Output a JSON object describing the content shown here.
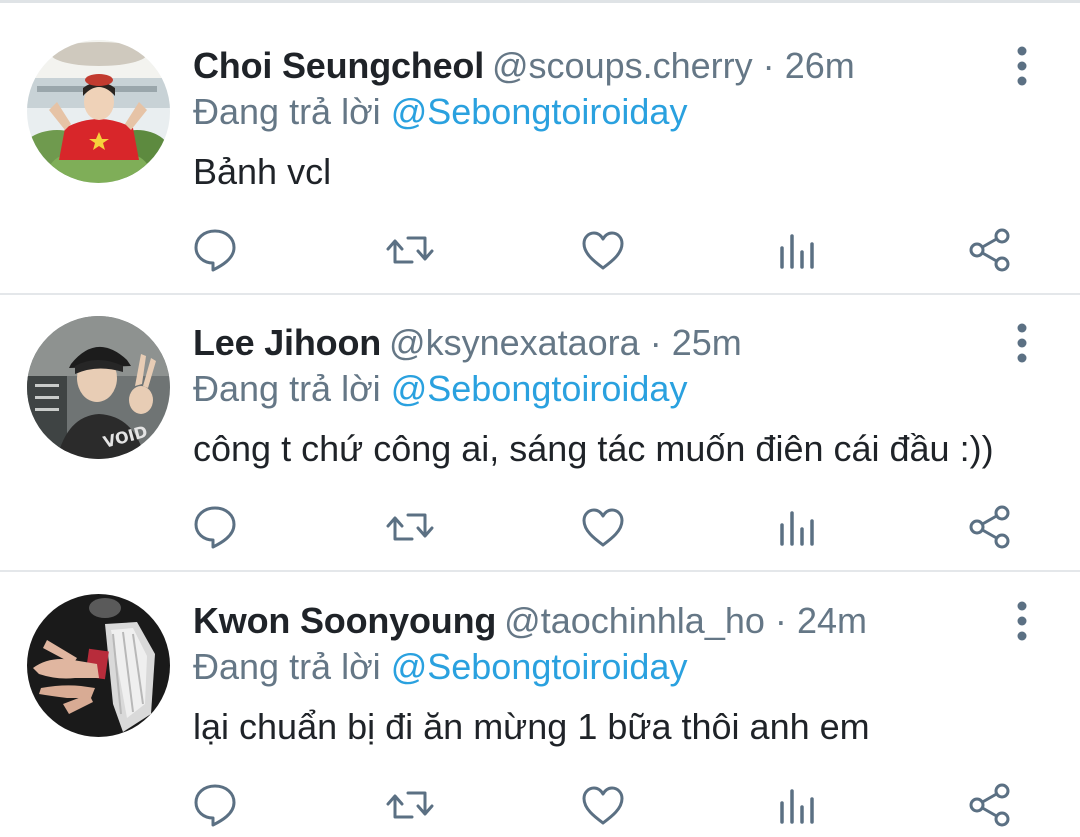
{
  "replies": [
    {
      "display_name": "Choi Seungcheol",
      "handle": "@scoups.cherry",
      "time": "26m",
      "reply_prefix": "Đang trả lời",
      "reply_to": "@Sebongtoiroiday",
      "text": "Bảnh vcl"
    },
    {
      "display_name": "Lee Jihoon",
      "handle": "@ksynexataora",
      "time": "25m",
      "reply_prefix": "Đang trả lời",
      "reply_to": "@Sebongtoiroiday",
      "text": "công t chứ công ai, sáng tác muốn điên cái đầu :))"
    },
    {
      "display_name": "Kwon Soonyoung",
      "handle": "@taochinhla_ho",
      "time": "24m",
      "reply_prefix": "Đang trả lời",
      "reply_to": "@Sebongtoiroiday",
      "text": "lại chuẩn bị đi ăn mừng 1 bữa thôi anh em"
    }
  ],
  "separator": "·",
  "icons": {
    "reply": "comment-icon",
    "retweet": "retweet-icon",
    "like": "heart-icon",
    "analytics": "analytics-icon",
    "share": "share-icon",
    "more": "vertical-dots-icon"
  },
  "colors": {
    "mention": "#2aa1df",
    "secondary_text": "#657786",
    "primary_text": "#1f2328",
    "icon": "#5b7083",
    "divider": "#e4e7ea"
  }
}
